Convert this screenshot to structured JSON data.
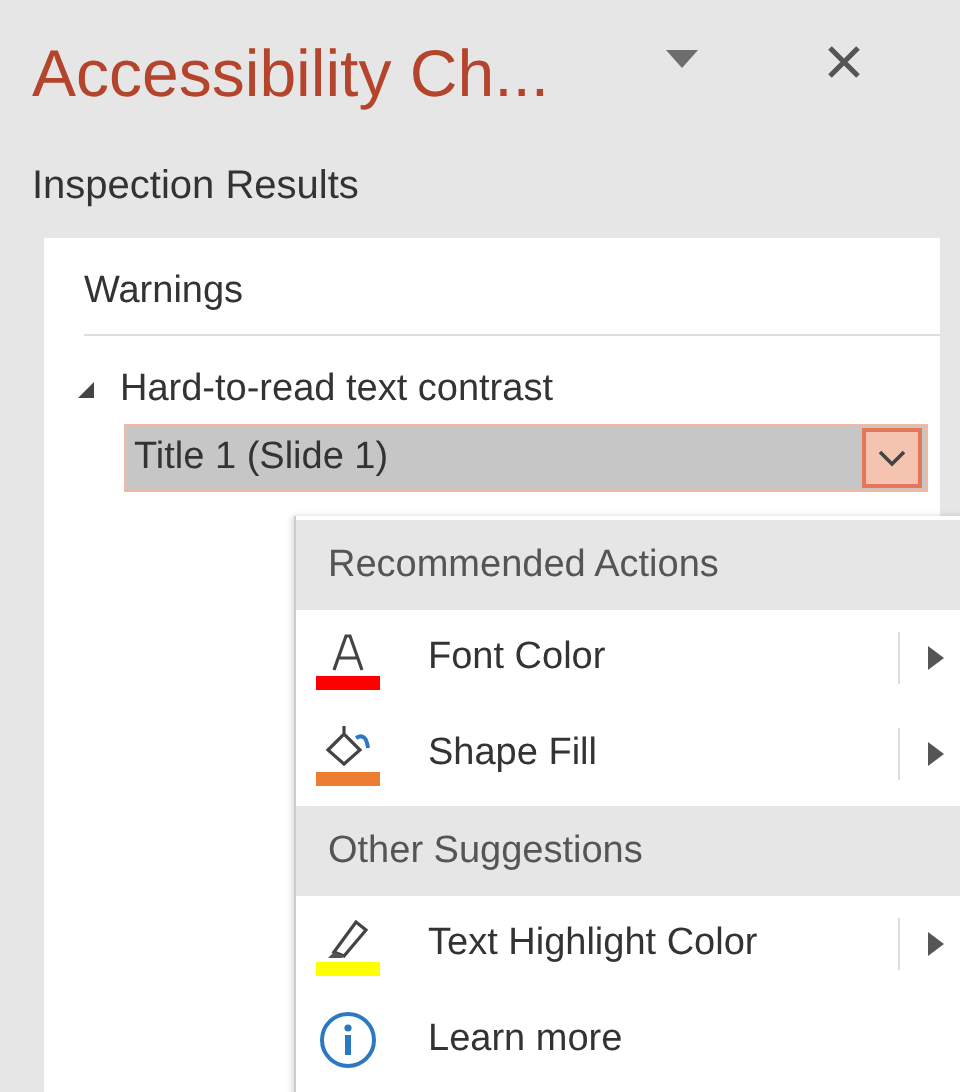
{
  "pane": {
    "title": "Accessibility Ch...",
    "section_label": "Inspection Results"
  },
  "results": {
    "heading": "Warnings",
    "tree": [
      {
        "label": "Hard-to-read text contrast",
        "expanded": true,
        "children": [
          {
            "label": "Title 1  (Slide 1)",
            "selected": true
          }
        ]
      }
    ]
  },
  "menu": [
    {
      "kind": "header",
      "label": "Recommended Actions"
    },
    {
      "kind": "fontcolor",
      "label": "Font Color",
      "color": "#ff0000"
    },
    {
      "kind": "fill",
      "label": "Shape Fill",
      "color": "#ed7d31"
    },
    {
      "kind": "header",
      "label": "Other Suggestions"
    },
    {
      "kind": "highlight",
      "label": "Text Highlight Color",
      "color": "#ffff00"
    },
    {
      "kind": "info",
      "label": "Learn more"
    }
  ]
}
